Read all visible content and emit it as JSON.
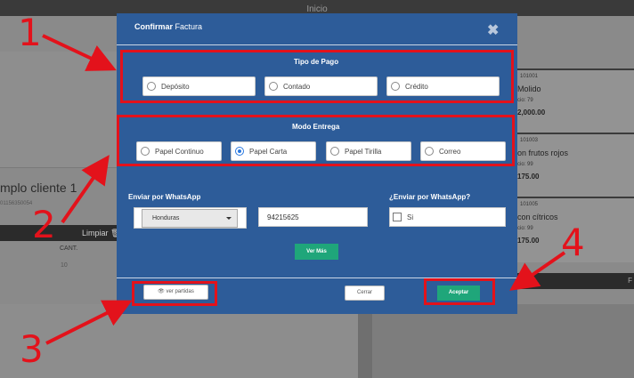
{
  "background": {
    "top_title": "Inicio",
    "client_name": "mplo cliente 1",
    "client_sub": "01156350054",
    "limpiar": "Limpiar",
    "cant_header": "CANT.",
    "cant_value": "10",
    "products": [
      {
        "code": "101001",
        "name": "Molido",
        "stock": "cio: 79",
        "price": "2,000.00"
      },
      {
        "code": "101003",
        "name": "on frutos rojos",
        "stock": "cio: 99",
        "price": "175.00"
      },
      {
        "code": "101005",
        "name": "con cítricos",
        "stock": "cio: 99",
        "price": "175.00"
      }
    ],
    "right_bar_text": "F"
  },
  "modal": {
    "title_bold": "Confirmar",
    "title_rest": "Factura",
    "close_glyph": "✖",
    "tipo_pago": {
      "title": "Tipo de Pago",
      "options": [
        {
          "label": "Depósito",
          "selected": false
        },
        {
          "label": "Contado",
          "selected": false
        },
        {
          "label": "Crédito",
          "selected": false
        }
      ]
    },
    "modo_entrega": {
      "title": "Modo Entrega",
      "options": [
        {
          "label": "Papel Continuo",
          "selected": false
        },
        {
          "label": "Papel Carta",
          "selected": true
        },
        {
          "label": "Papel Tirilla",
          "selected": false
        },
        {
          "label": "Correo",
          "selected": false
        }
      ]
    },
    "whatsapp": {
      "label": "Enviar por WhatsApp",
      "country": "Honduras",
      "phone": "94215625",
      "ask_label": "¿Enviar por WhatsApp?",
      "check_label": "Si",
      "checked": false
    },
    "ver_mas": "Ver Más",
    "footer": {
      "ver_partidas": "ver partidas",
      "cerrar": "Cerrar",
      "aceptar": "Aceptar"
    }
  },
  "annotations": {
    "labels": [
      "1",
      "2",
      "3",
      "4"
    ]
  },
  "colors": {
    "modal_bg": "#2d5c99",
    "accent_green": "#1fa67a",
    "annotation_red": "#e3121b",
    "radio_selected": "#2b79e0"
  }
}
